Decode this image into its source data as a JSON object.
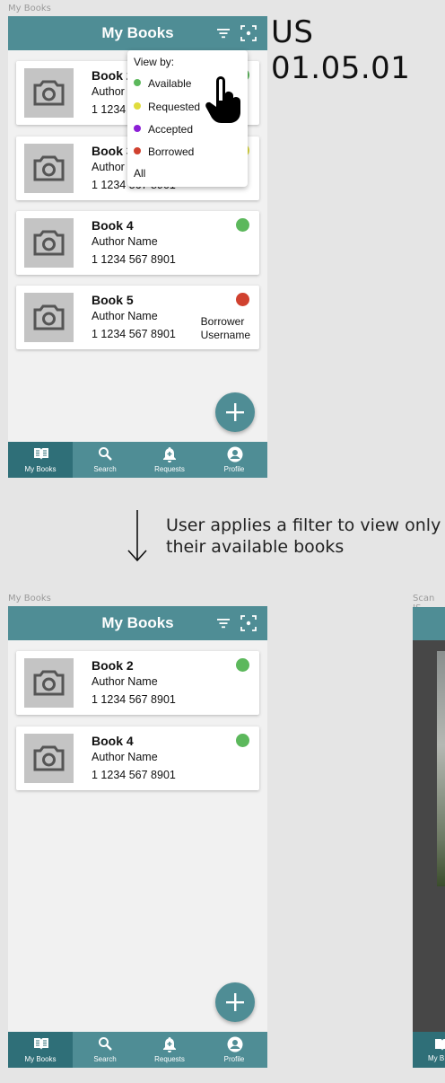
{
  "story_id": "US 01.05.01",
  "frames": {
    "top_label": "My Books",
    "bottom_label": "My Books",
    "scan_label": "Scan IS"
  },
  "app": {
    "title": "My Books",
    "icons": {
      "filter": "filter-icon",
      "scan": "scan-icon",
      "camera": "camera-icon",
      "add": "plus-icon"
    }
  },
  "status_colors": {
    "available": "#5cb85c",
    "requested": "#e0dc3c",
    "accepted": "#8c1fd6",
    "borrowed": "#d0412f",
    "accent": "#4f8d95"
  },
  "top_screen": {
    "books": [
      {
        "title": "Book 2",
        "author": "Author",
        "isbn": "1 1234",
        "status": "available"
      },
      {
        "title": "Book 3",
        "author": "Author",
        "isbn": "1 1234 567 8901",
        "status": "requested"
      },
      {
        "title": "Book 4",
        "author": "Author Name",
        "isbn": "1 1234 567 8901",
        "status": "available"
      },
      {
        "title": "Book 5",
        "author": "Author Name",
        "isbn": "1 1234 567 8901",
        "status": "borrowed",
        "borrower_line1": "Borrower",
        "borrower_line2": "Username"
      }
    ],
    "filter_menu": {
      "heading": "View by:",
      "options": [
        {
          "label": "Available",
          "status": "available"
        },
        {
          "label": "Requested",
          "status": "requested"
        },
        {
          "label": "Accepted",
          "status": "accepted"
        },
        {
          "label": "Borrowed",
          "status": "borrowed"
        },
        {
          "label": "All"
        }
      ]
    }
  },
  "bottom_screen": {
    "books": [
      {
        "title": "Book 2",
        "author": "Author Name",
        "isbn": "1 1234 567 8901",
        "status": "available"
      },
      {
        "title": "Book 4",
        "author": "Author Name",
        "isbn": "1 1234 567 8901",
        "status": "available"
      }
    ]
  },
  "nav": {
    "items": [
      {
        "label": "My Books",
        "icon": "book-icon"
      },
      {
        "label": "Search",
        "icon": "search-icon"
      },
      {
        "label": "Requests",
        "icon": "bell-icon"
      },
      {
        "label": "Profile",
        "icon": "profile-icon"
      }
    ]
  },
  "transition_caption": {
    "line1": "User applies a filter to view only",
    "line2": "their available books"
  },
  "scan_screen": {
    "nav_label": "My B"
  }
}
